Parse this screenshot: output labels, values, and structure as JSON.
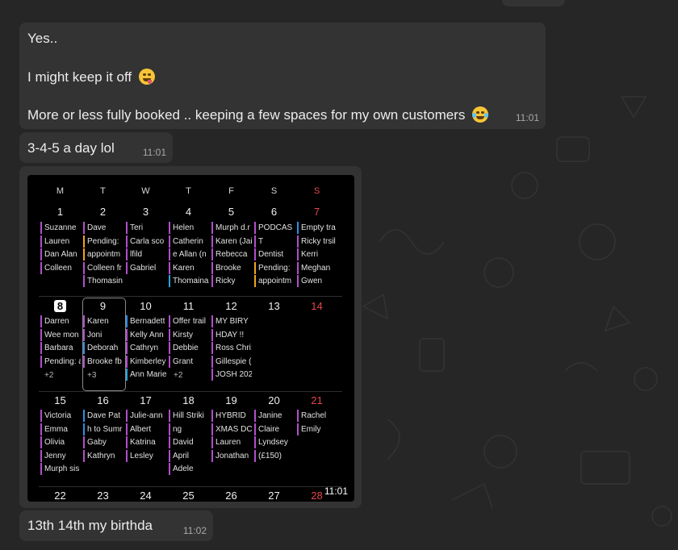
{
  "messages": [
    {
      "lines": [
        "Yes..",
        "I might keep it off",
        "More or less fully booked .. keeping a few spaces for my own customers"
      ],
      "time": "11:01"
    },
    {
      "lines": [
        "3-4-5 a day lol"
      ],
      "time": "11:01"
    },
    {
      "image_time": "11:01"
    },
    {
      "lines": [
        "13th 14th my birthda"
      ],
      "time": "11:02"
    }
  ],
  "icons": {
    "emoji1": "zany-face-icon",
    "emoji2": "tears-of-joy-icon"
  },
  "calendar": {
    "weekdays": [
      "M",
      "T",
      "W",
      "T",
      "F",
      "S",
      "S"
    ],
    "week1": {
      "days": [
        "1",
        "2",
        "3",
        "4",
        "5",
        "6",
        "7"
      ],
      "events": [
        [
          "Suzanne",
          "Lauren",
          "Dan Alan",
          "Colleen"
        ],
        [
          "Dave",
          "Pending:",
          "appointm",
          "Colleen fr",
          "Thomasin"
        ],
        [
          "Teri",
          "Carla sco",
          "lfild",
          "Gabriel"
        ],
        [
          "Helen",
          "Catherin",
          "e Allan (n",
          "Karen",
          "Thomaina"
        ],
        [
          "Murph d.r",
          "Karen (Jai",
          "Rebecca",
          "Brooke",
          "Ricky"
        ],
        [
          "PODCAS",
          "T",
          "Dentist",
          "Pending:",
          "appointm"
        ],
        [
          "Empty tra",
          "Ricky trsil",
          "Kerri",
          "Meghan",
          "Gwen"
        ]
      ]
    },
    "week2": {
      "days": [
        "8",
        "9",
        "10",
        "11",
        "12",
        "13",
        "14"
      ],
      "events": [
        [
          "Darren",
          "Wee mon",
          "Barbara",
          "Pending: a"
        ],
        [
          "Karen",
          "Joni",
          "Deborah",
          "Brooke fb"
        ],
        [
          "Bernadett",
          "Kelly Ann",
          "Cathryn",
          "Kimberley",
          "Ann Marie"
        ],
        [
          "Offer trail",
          "Kirsty",
          "Debbie",
          "Grant"
        ],
        [
          "MY BIRY",
          "HDAY !!",
          "Ross Chri:",
          "Gillespie (",
          "JOSH 202"
        ],
        [],
        []
      ],
      "more": {
        "mon": "+2",
        "tue": "+3",
        "thu": "+2"
      }
    },
    "week3": {
      "days": [
        "15",
        "16",
        "17",
        "18",
        "19",
        "20",
        "21"
      ],
      "events": [
        [
          "Victoria",
          "Emma",
          "Olivia",
          "Jenny",
          "Murph sis"
        ],
        [
          "Dave Pat",
          "h to Sumr",
          "Gaby",
          "Kathryn"
        ],
        [
          "Julie-ann",
          "Albert",
          "Katrina",
          "Lesley"
        ],
        [
          "Hill Striki",
          "ng",
          "David",
          "April",
          "Adele"
        ],
        [
          "HYBRID",
          "XMAS DC",
          "Lauren",
          "Jonathan"
        ],
        [
          "Janine",
          "Claire",
          "Lyndsey",
          "(£150)"
        ],
        [
          "Rachel",
          "Emily"
        ]
      ]
    },
    "week4": {
      "days": [
        "22",
        "23",
        "24",
        "25",
        "26",
        "27",
        "28"
      ]
    }
  }
}
